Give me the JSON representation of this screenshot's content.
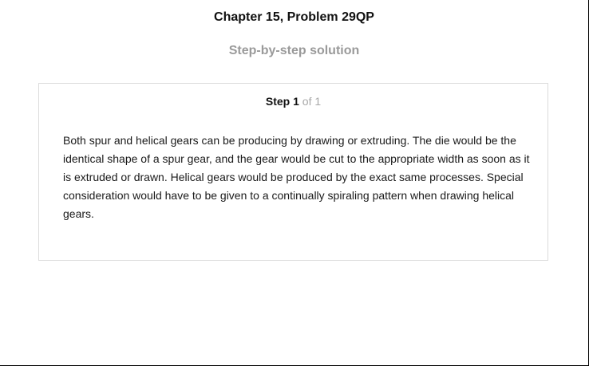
{
  "header": {
    "chapter_title": "Chapter 15, Problem 29QP",
    "subtitle": "Step-by-step solution"
  },
  "step": {
    "label": "Step",
    "number": "1",
    "of_text": "of 1",
    "body": "Both spur and helical gears can be producing by drawing or extruding. The die would be the identical shape of a spur gear, and the gear would be cut to the appropriate width as soon as it is extruded or drawn. Helical gears would be produced by the exact same processes. Special consideration would have to be given to a continually spiraling pattern when drawing helical gears."
  }
}
